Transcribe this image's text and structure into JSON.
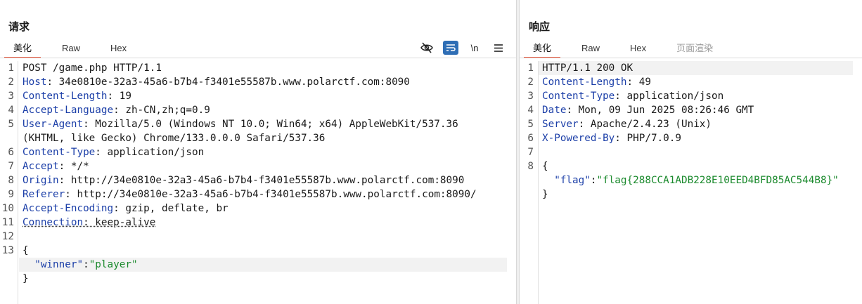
{
  "request": {
    "title": "请求",
    "tabs": [
      "美化",
      "Raw",
      "Hex"
    ],
    "toolbar": {
      "newline_label": "\\n"
    },
    "lines": [
      {
        "n": "1",
        "plain": "POST /game.php HTTP/1.1"
      },
      {
        "n": "2",
        "name": "Host",
        "value": " 34e0810e-32a3-45a6-b7b4-f3401e55587b.www.polarctf.com:8090"
      },
      {
        "n": "3",
        "name": "Content-Length",
        "value": " 19"
      },
      {
        "n": "4",
        "name": "Accept-Language",
        "value": " zh-CN,zh;q=0.9"
      },
      {
        "n": "5",
        "name": "User-Agent",
        "value": " Mozilla/5.0 (Windows NT 10.0; Win64; x64) AppleWebKit/537.36"
      },
      {
        "n": "",
        "plain": "(KHTML, like Gecko) Chrome/133.0.0.0 Safari/537.36"
      },
      {
        "n": "6",
        "name": "Content-Type",
        "value": " application/json"
      },
      {
        "n": "7",
        "name": "Accept",
        "value": " */*"
      },
      {
        "n": "8",
        "name": "Origin",
        "value": " http://34e0810e-32a3-45a6-b7b4-f3401e55587b.www.polarctf.com:8090"
      },
      {
        "n": "9",
        "name": "Referer",
        "value": " http://34e0810e-32a3-45a6-b7b4-f3401e55587b.www.polarctf.com:8090/"
      },
      {
        "n": "10",
        "name": "Accept-Encoding",
        "value": " gzip, deflate, br"
      },
      {
        "n": "11",
        "name": "Connection",
        "value": " keep-alive"
      },
      {
        "n": "12",
        "plain": ""
      },
      {
        "n": "13",
        "plain": "{"
      },
      {
        "n": "",
        "json_key": "\"winner\"",
        "sep": ":",
        "json_val": "\"player\""
      },
      {
        "n": "",
        "plain": "}"
      }
    ]
  },
  "response": {
    "title": "响应",
    "tabs": [
      "美化",
      "Raw",
      "Hex",
      "页面渲染"
    ],
    "lines": [
      {
        "n": "1",
        "plain": "HTTP/1.1 200 OK"
      },
      {
        "n": "2",
        "name": "Content-Length",
        "value": " 49"
      },
      {
        "n": "3",
        "name": "Content-Type",
        "value": " application/json"
      },
      {
        "n": "4",
        "name": "Date",
        "value": " Mon, 09 Jun 2025 08:26:46 GMT"
      },
      {
        "n": "5",
        "name": "Server",
        "value": " Apache/2.4.23 (Unix)"
      },
      {
        "n": "6",
        "name": "X-Powered-By",
        "value": " PHP/7.0.9"
      },
      {
        "n": "7",
        "plain": ""
      },
      {
        "n": "8",
        "plain": "{"
      },
      {
        "n": "",
        "json_key": "\"flag\"",
        "sep": ":",
        "json_val": "\"flag{288CCA1ADB228E10EED4BFD85AC544B8}\""
      },
      {
        "n": "",
        "plain": "}"
      }
    ]
  }
}
